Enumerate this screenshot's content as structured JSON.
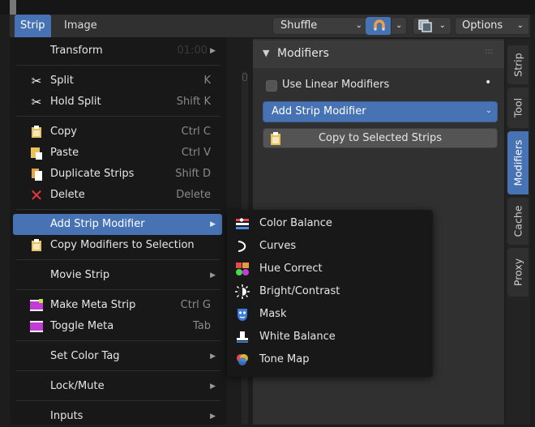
{
  "header": {
    "tabs": [
      {
        "label": "Strip",
        "active": true
      },
      {
        "label": "Image",
        "active": false
      }
    ],
    "shuffle_label": "Shuffle",
    "options_label": "Options"
  },
  "panel": {
    "title": "Modifiers",
    "use_linear_label": "Use Linear Modifiers",
    "add_modifier_label": "Add Strip Modifier",
    "copy_selected_label": "Copy to Selected Strips"
  },
  "vertical_tabs": [
    {
      "label": "Strip",
      "active": false
    },
    {
      "label": "Tool",
      "active": false
    },
    {
      "label": "Modifiers",
      "active": true
    },
    {
      "label": "Cache",
      "active": false
    },
    {
      "label": "Proxy",
      "active": false
    }
  ],
  "strip_menu": {
    "transform": {
      "label": "Transform",
      "shortcut": "01:00"
    },
    "split": {
      "label": "Split",
      "shortcut": "K"
    },
    "hold_split": {
      "label": "Hold Split",
      "shortcut": "Shift K"
    },
    "copy": {
      "label": "Copy",
      "shortcut": "Ctrl C"
    },
    "paste": {
      "label": "Paste",
      "shortcut": "Ctrl V"
    },
    "duplicate": {
      "label": "Duplicate Strips",
      "shortcut": "Shift D"
    },
    "delete": {
      "label": "Delete",
      "shortcut": "Delete"
    },
    "add_strip_modifier": {
      "label": "Add Strip Modifier"
    },
    "copy_modifiers": {
      "label": "Copy Modifiers to Selection"
    },
    "movie_strip": {
      "label": "Movie Strip"
    },
    "make_meta": {
      "label": "Make Meta Strip",
      "shortcut": "Ctrl G"
    },
    "toggle_meta": {
      "label": "Toggle Meta",
      "shortcut": "Tab"
    },
    "set_color_tag": {
      "label": "Set Color Tag"
    },
    "lock_mute": {
      "label": "Lock/Mute"
    },
    "inputs": {
      "label": "Inputs"
    }
  },
  "submenu": [
    {
      "label": "Color Balance",
      "icon": "color-balance-icon"
    },
    {
      "label": "Curves",
      "icon": "curves-icon"
    },
    {
      "label": "Hue Correct",
      "icon": "hue-correct-icon"
    },
    {
      "label": "Bright/Contrast",
      "icon": "bright-contrast-icon"
    },
    {
      "label": "Mask",
      "icon": "mask-icon"
    },
    {
      "label": "White Balance",
      "icon": "white-balance-icon"
    },
    {
      "label": "Tone Map",
      "icon": "tone-map-icon"
    }
  ],
  "colors": {
    "accent": "#4772b3",
    "menu_bg": "#181818",
    "panel_bg": "#303030"
  }
}
